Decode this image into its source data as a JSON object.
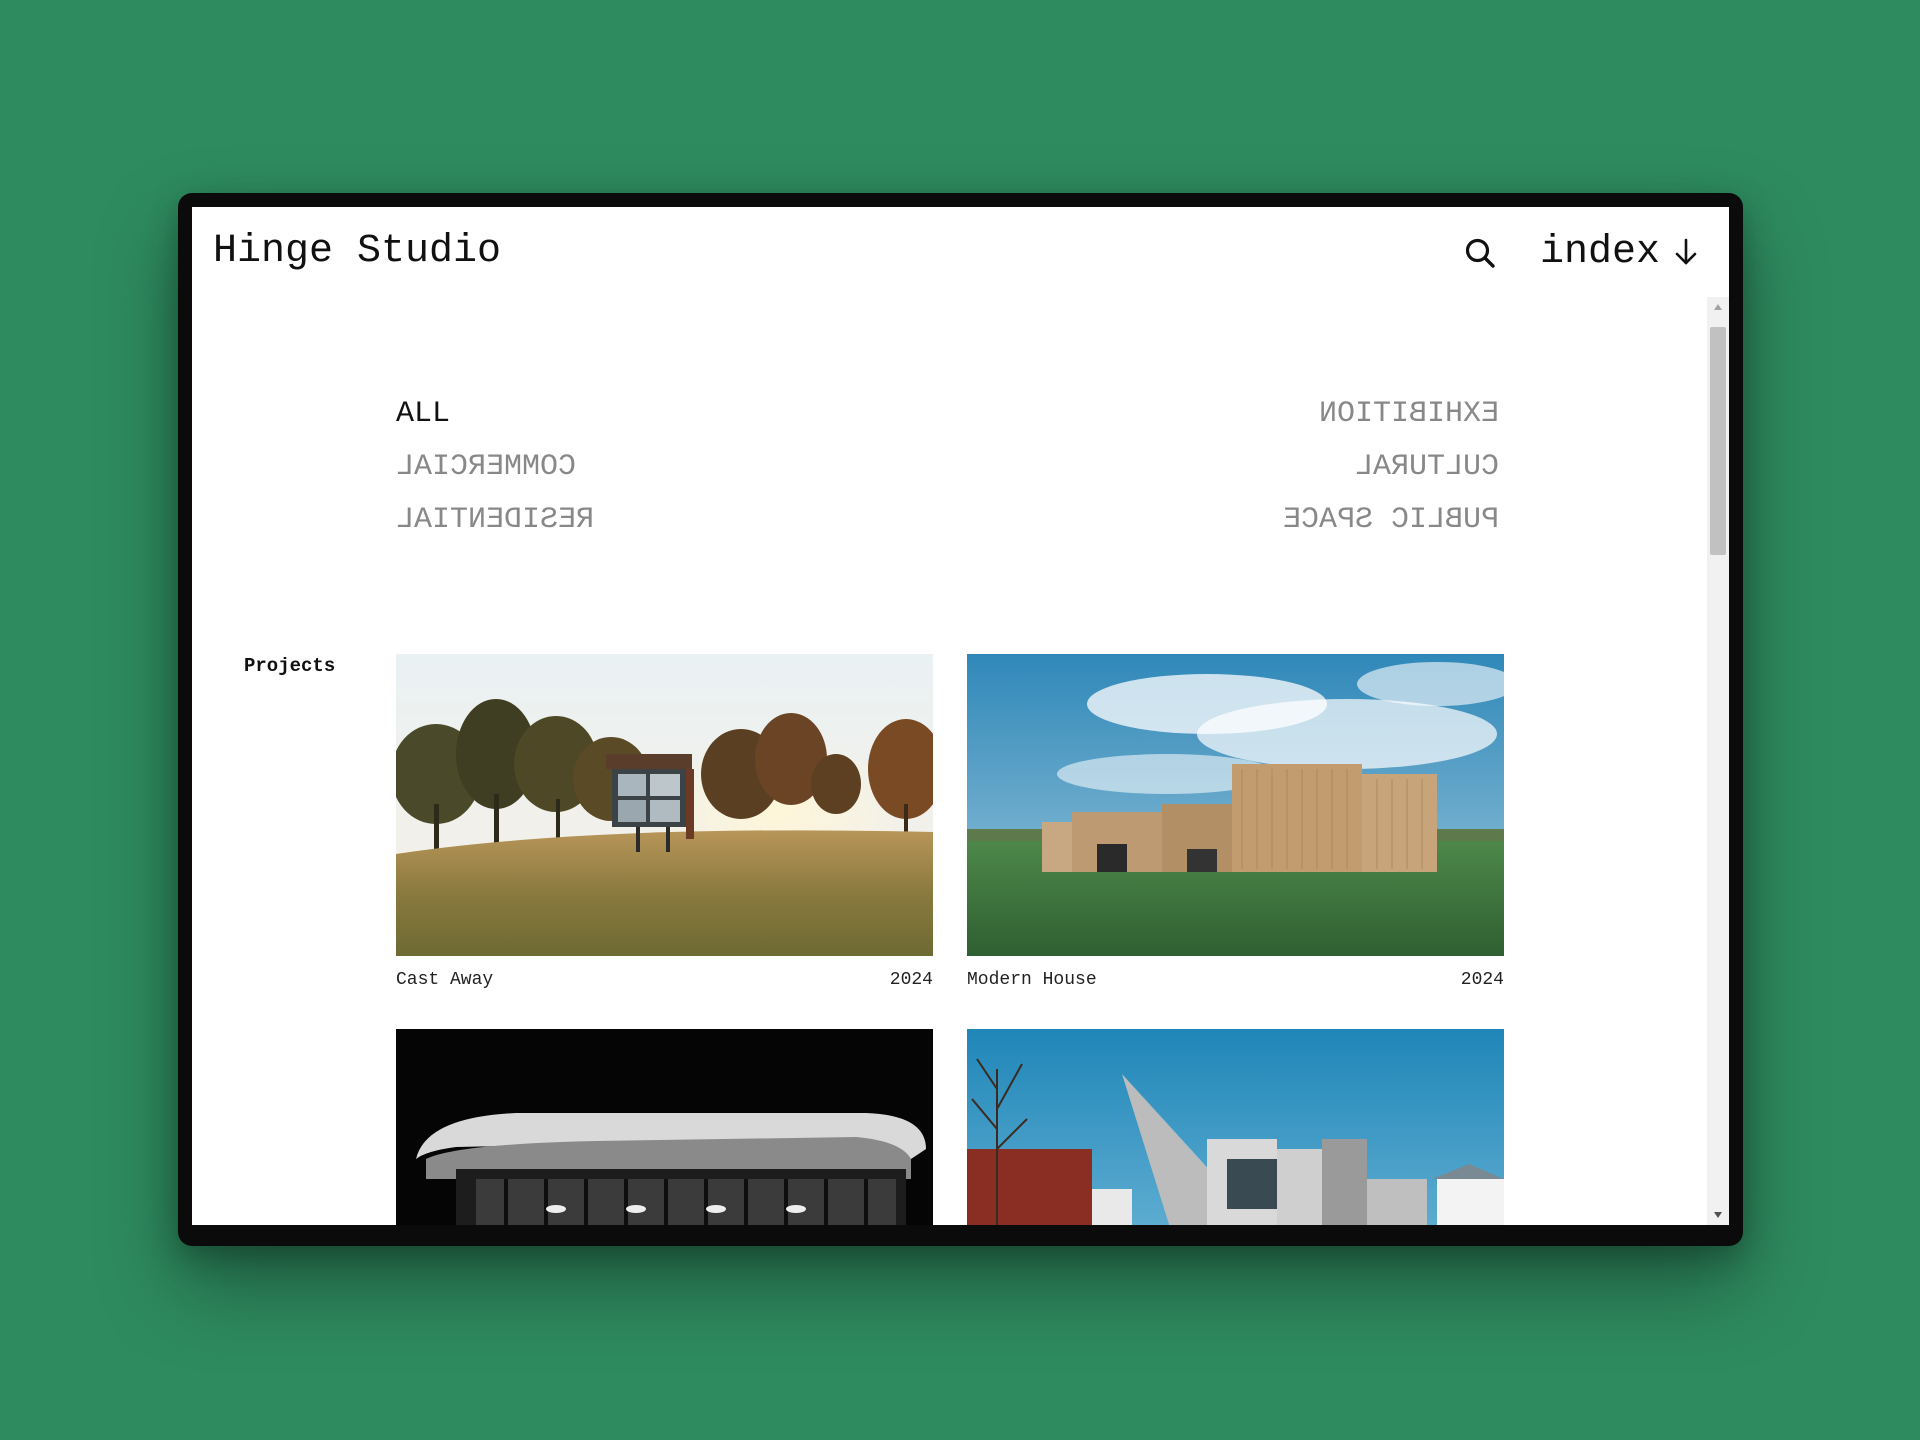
{
  "header": {
    "brand": "Hinge Studio",
    "index_label": "index",
    "search_icon": "search-icon",
    "index_icon": "arrow-down-icon"
  },
  "filters": {
    "left": [
      "ALL",
      "COMMERCIAL",
      "RESIDENTIAL"
    ],
    "right": [
      "EXHIBITION",
      "CULTURAL",
      "PUBLIC SPACE"
    ],
    "active": "ALL"
  },
  "projects": {
    "label": "Projects",
    "items": [
      {
        "title": "Cast Away",
        "year": "2024"
      },
      {
        "title": "Modern House",
        "year": "2024"
      },
      {
        "title": "",
        "year": ""
      },
      {
        "title": "",
        "year": ""
      }
    ]
  },
  "colors": {
    "background": "#2e8b5f",
    "frame": "#0b0b0b",
    "text": "#111111",
    "muted_filter": "#888888"
  }
}
